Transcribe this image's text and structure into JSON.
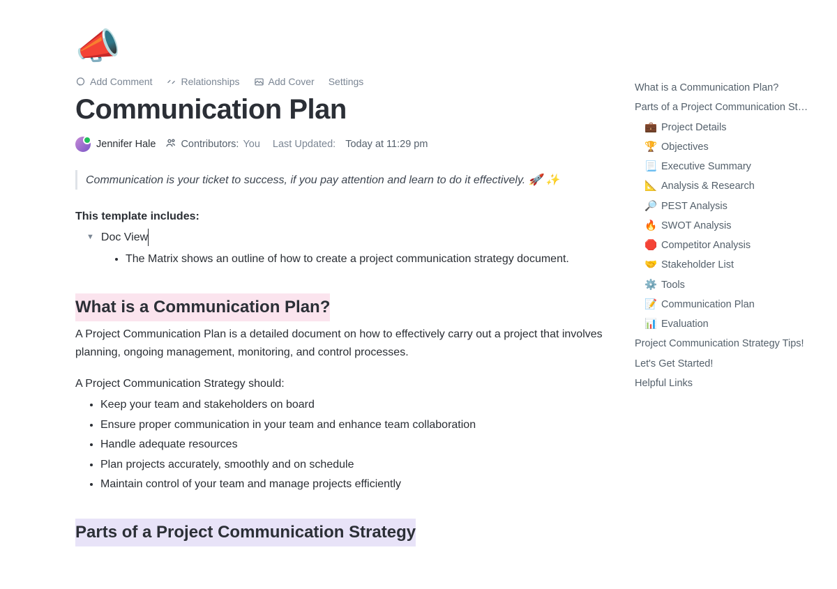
{
  "toolbar": {
    "add_comment": "Add Comment",
    "relationships": "Relationships",
    "add_cover": "Add Cover",
    "settings": "Settings"
  },
  "title": "Communication Plan",
  "meta": {
    "owner": "Jennifer Hale",
    "contributors_label": "Contributors:",
    "contributors_value": "You",
    "updated_label": "Last Updated:",
    "updated_value": "Today at 11:29 pm"
  },
  "quote": "Communication is your ticket to success, if you pay attention and learn to do it effectively. 🚀 ✨",
  "template_includes_label": "This template includes:",
  "doc_view": "Doc View",
  "doc_view_bullet": "The Matrix shows an outline of how to create a project communication strategy document.",
  "section_what": {
    "heading": "What is a Communication Plan?",
    "para": "A Project Communication Plan is a detailed document on how to effectively carry out a project that involves planning, ongoing management, monitoring, and control processes.",
    "should_label": "A Project Communication Strategy should:",
    "bullets": [
      "Keep your team and stakeholders on board",
      "Ensure proper communication in your team and enhance team collaboration",
      "Handle adequate resources",
      "Plan projects accurately, smoothly and on schedule",
      "Maintain control of your team and manage projects efficiently"
    ]
  },
  "section_parts": {
    "heading": "Parts of a Project Communication Strategy"
  },
  "outline": {
    "root": [
      "What is a Communication Plan?",
      "Parts of a Project Communication St…"
    ],
    "subs": [
      {
        "icon": "💼",
        "label": "Project Details"
      },
      {
        "icon": "🏆",
        "label": "Objectives"
      },
      {
        "icon": "📃",
        "label": "Executive Summary"
      },
      {
        "icon": "📐",
        "label": "Analysis & Research"
      },
      {
        "icon": "🔎",
        "label": "PEST Analysis"
      },
      {
        "icon": "🔥",
        "label": "SWOT Analysis"
      },
      {
        "icon": "🛑",
        "label": "Competitor Analysis"
      },
      {
        "icon": "🤝",
        "label": "Stakeholder List"
      },
      {
        "icon": "⚙️",
        "label": "Tools"
      },
      {
        "icon": "📝",
        "label": "Communication Plan"
      },
      {
        "icon": "📊",
        "label": "Evaluation"
      }
    ],
    "tail": [
      "Project Communication Strategy Tips!",
      "Let's Get Started!",
      "Helpful Links"
    ]
  }
}
